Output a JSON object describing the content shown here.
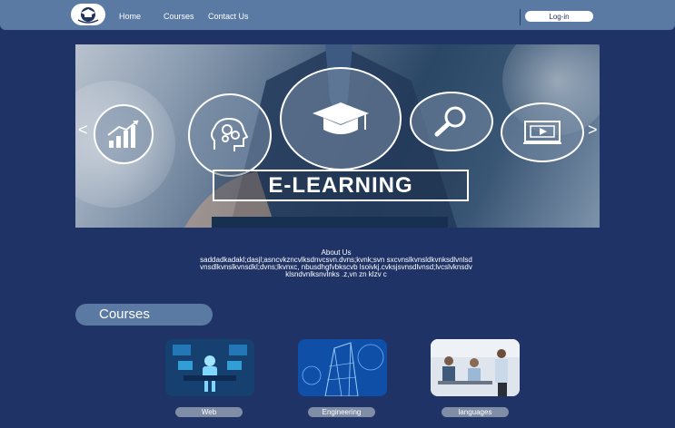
{
  "nav": {
    "logo_icon": "graduation-cap-logo",
    "links": [
      "Home",
      "Courses",
      "Contact Us"
    ],
    "login_label": "Log-in"
  },
  "hero": {
    "banner_text": "E-LEARNING",
    "prev_arrow": "<",
    "next_arrow": ">",
    "icons": [
      "bar-chart-icon",
      "brain-gears-icon",
      "graduation-cap-icon",
      "magnifier-icon",
      "video-screen-icon"
    ]
  },
  "about": {
    "title": "About Us",
    "body": "saddadkadakl;dasjl;asncvkzncvlksdnvcsvn.dvns;kvnk;svn sxcvnslkvnsldkvnksdlvnlsdvnsdlkvnslkvnsdkl;dvns;lkvnxc, nbusdhgfvbkscvb lsoivkj.cvksjsvnsdlvnsd;lvcslvknsdvklsndvnlksnvlnks .z,vn zn klzv c"
  },
  "courses": {
    "heading": "Courses",
    "items": [
      {
        "label": "Web"
      },
      {
        "label": "Engineering"
      },
      {
        "label": "languages"
      }
    ]
  },
  "colors": {
    "background": "#1f3366",
    "navbar": "#5a7aa3",
    "course_button": "#7f8da6"
  }
}
